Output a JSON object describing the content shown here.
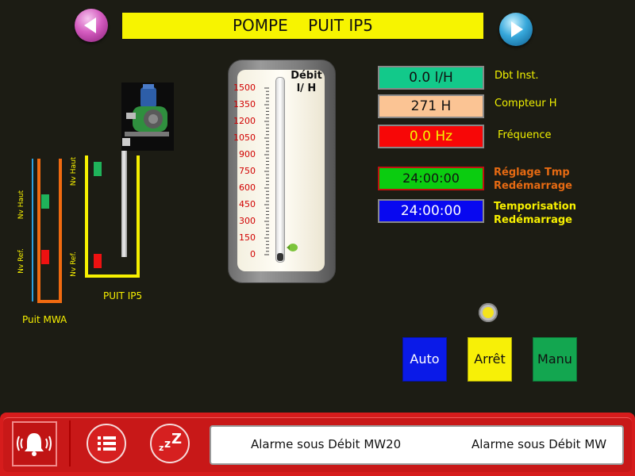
{
  "header": {
    "title": "POMPE    PUIT IP5",
    "prev_icon": "arrow-left-icon",
    "next_icon": "arrow-right-icon"
  },
  "wells": {
    "mwa": {
      "label": "Puit MWA",
      "nv_haut": "Nv Haut",
      "nv_ref": "Nv Ref.",
      "haut_color": "#1fb35a",
      "ref_color": "#ee1111"
    },
    "ip5": {
      "label": "PUIT IP5",
      "nv_haut": "Nv Haut",
      "nv_ref": "Nv Ref.",
      "haut_color": "#1fb35a",
      "ref_color": "#ee1111"
    }
  },
  "gauge": {
    "title_line1": "Débit",
    "title_line2": "l/ H",
    "ticks": [
      "1500",
      "1350",
      "1200",
      "1050",
      "900",
      "750",
      "600",
      "450",
      "300",
      "150",
      "0"
    ],
    "value": 0
  },
  "values": {
    "debit": {
      "value": "0.0 l/H",
      "label": "Dbt Inst.",
      "bg": "#12c98a"
    },
    "compteur": {
      "value": "271 H",
      "label": "Compteur H",
      "bg": "#fbc494"
    },
    "frequence": {
      "value": "0.0 Hz",
      "label": "Fréquence",
      "bg": "#f70707",
      "fg": "#f5f500"
    },
    "reglage": {
      "value": "24:00:00",
      "label_line1": "Réglage Tmp",
      "label_line2": "Redémarrage",
      "bg": "#0bcc10"
    },
    "tempo": {
      "value": "24:00:00",
      "label_line1": "Temporisation",
      "label_line2": "Redémarrage",
      "bg": "#0808f0",
      "fg": "#ffffff"
    }
  },
  "status_light": {
    "color": "#f4e41e"
  },
  "modes": {
    "auto": {
      "label": "Auto",
      "bg": "#0a1ae8",
      "fg": "#ffffff"
    },
    "arret": {
      "label": "Arrêt",
      "bg": "#f7f007",
      "fg": "#111111"
    },
    "manu": {
      "label": "Manu",
      "bg": "#13a650",
      "fg": "#111111"
    }
  },
  "bottom_bar": {
    "bell_icon": "alarm-bell-icon",
    "list_icon": "list-icon",
    "sleep_icon": "sleep-zzz-icon",
    "alarms": [
      "Alarme sous Débit MW20",
      "Alarme sous Débit MW"
    ]
  }
}
